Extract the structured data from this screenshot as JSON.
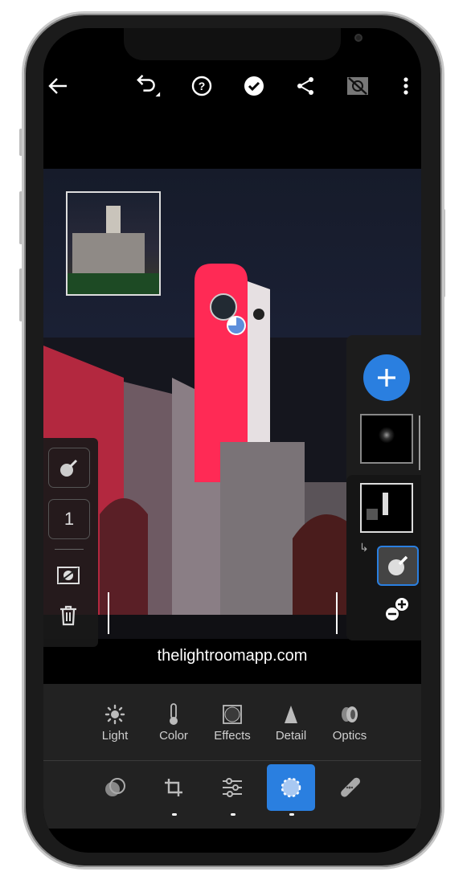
{
  "toolbar": {
    "icons": [
      "back-arrow-icon",
      "undo-icon",
      "help-icon",
      "checkmark-icon",
      "share-icon",
      "before-after-icon",
      "more-icon"
    ]
  },
  "photo": {
    "inset_label": ""
  },
  "left_panel": {
    "brush_count": "1",
    "icons": [
      "color-picker-icon",
      "invert-mask-icon",
      "trash-icon"
    ]
  },
  "right_panel": {
    "icons": [
      "add-mask-icon",
      "mask-thumbnail",
      "color-range-icon",
      "add-subtract-icon"
    ]
  },
  "watermark": "thelightroomapp.com",
  "tools": [
    {
      "label": "Light"
    },
    {
      "label": "Color"
    },
    {
      "label": "Effects"
    },
    {
      "label": "Detail"
    },
    {
      "label": "Optics"
    }
  ],
  "modes": [
    "presets-icon",
    "crop-icon",
    "edit-icon",
    "masking-icon",
    "healing-icon"
  ],
  "colors": {
    "accent": "#2a7fe0",
    "panel": "#222222",
    "mask_overlay": "#ff2a55"
  }
}
